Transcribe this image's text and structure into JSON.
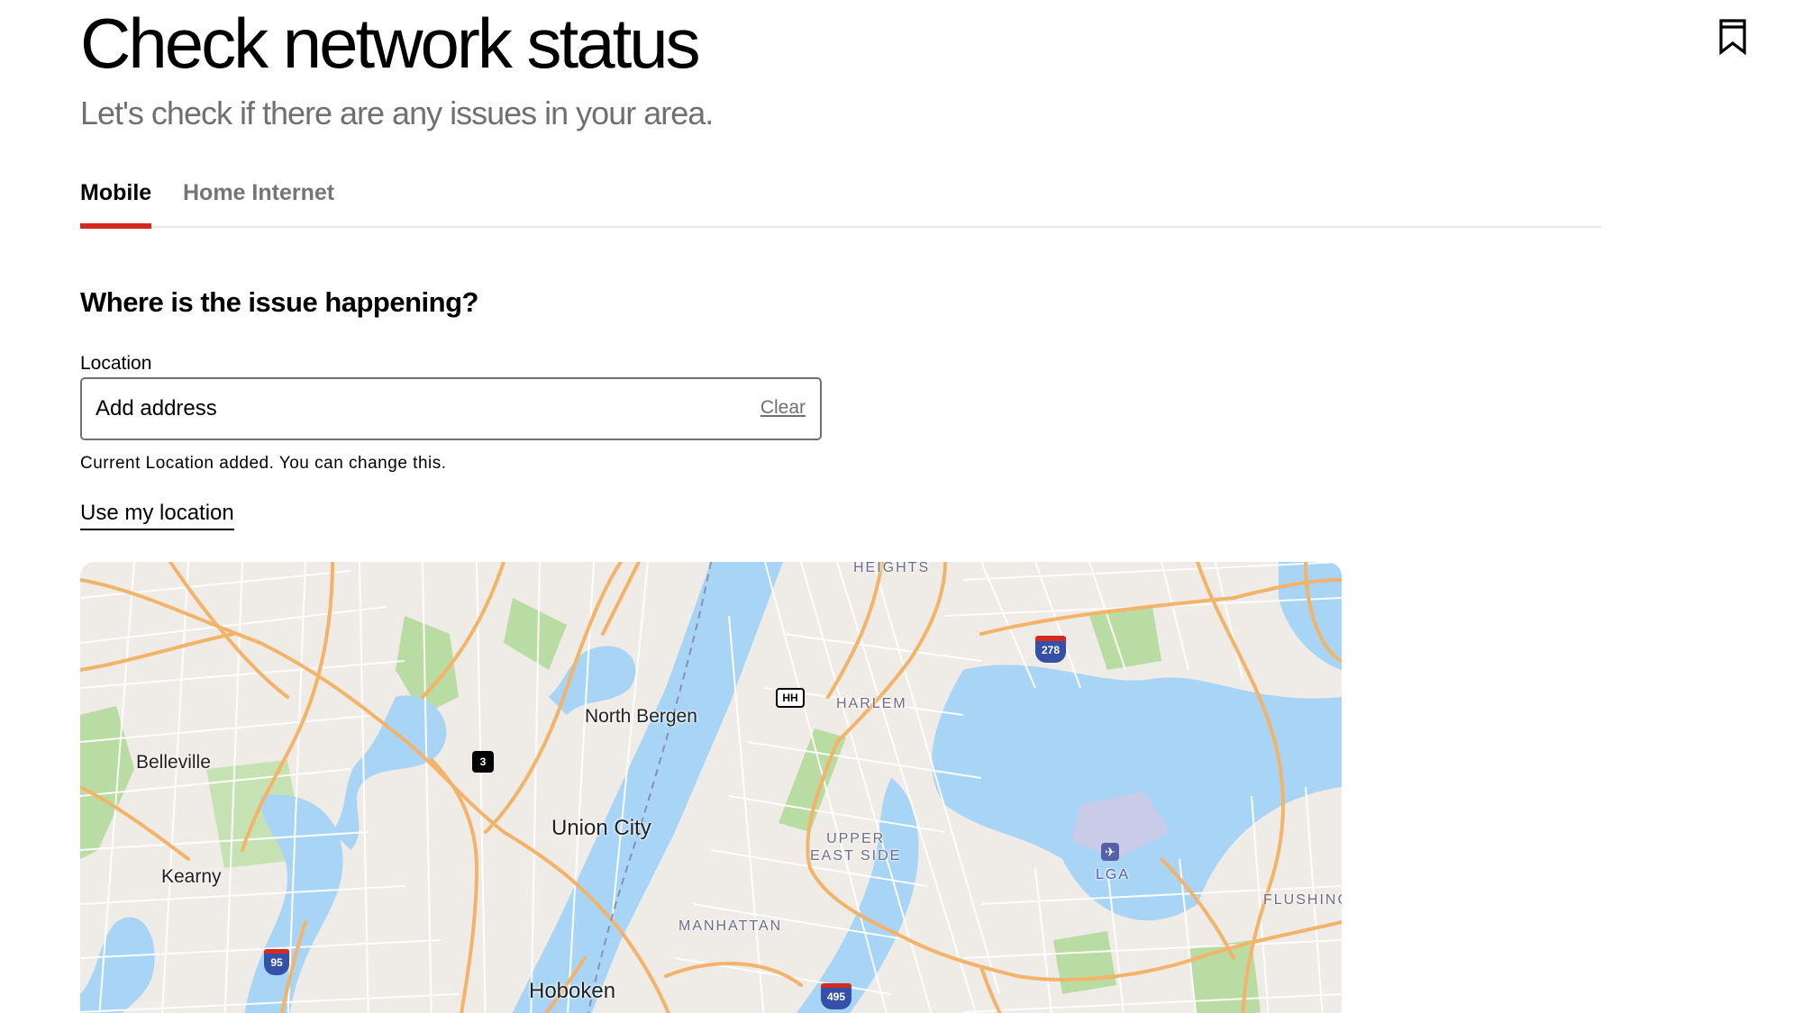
{
  "header": {
    "title": "Check network status",
    "subtitle": "Let's check if there are any issues in your area."
  },
  "tabs": [
    {
      "label": "Mobile",
      "active": true
    },
    {
      "label": "Home Internet",
      "active": false
    }
  ],
  "form": {
    "heading": "Where is the issue happening?",
    "location_label": "Location",
    "location_placeholder": "Add address",
    "clear_label": "Clear",
    "helper_text": "Current Location added. You can change this.",
    "use_location_label": "Use my location"
  },
  "map": {
    "labels": {
      "belleville": "Belleville",
      "north_bergen": "North Bergen",
      "union_city": "Union City",
      "kearny": "Kearny",
      "hoboken": "Hoboken",
      "harlem": "HARLEM",
      "heights": "HEIGHTS",
      "upper_east_side_1": "UPPER",
      "upper_east_side_2": "EAST SIDE",
      "manhattan": "MANHATTAN",
      "lga": "LGA",
      "flushing": "FLUSHING"
    },
    "shields": {
      "i278": "278",
      "hh": "HH",
      "nj3": "3",
      "i95": "95",
      "i495": "495"
    }
  },
  "colors": {
    "accent": "#d52b1e",
    "water": "#a8d4f5",
    "park": "#b8dca1",
    "land": "#efebe6",
    "highway": "#f3b46a"
  },
  "icons": {
    "bookmark": "bookmark-icon",
    "airport": "airport-icon"
  }
}
